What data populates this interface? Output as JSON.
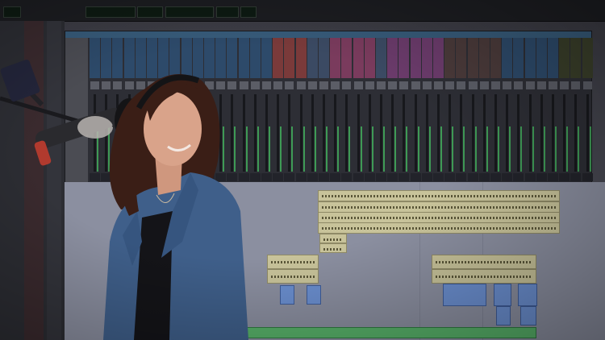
{
  "photo": {
    "subject": "singer-in-studio",
    "background": "daw-session-screen",
    "colors": {
      "jacket": "#3f5f8a",
      "hair": "#3a1e16",
      "skin": "#d9a38a",
      "shirt": "#141418",
      "mic_cable": "#b13a2e"
    }
  }
}
